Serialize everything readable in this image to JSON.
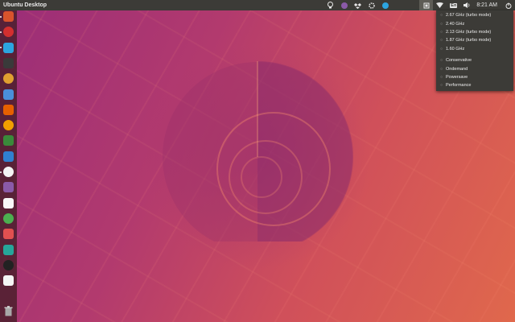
{
  "top_panel": {
    "title": "Ubuntu Desktop",
    "clock": "8:21 AM",
    "indicators": [
      "lightbulb-icon",
      "app-indicator-icon",
      "dropbox-icon",
      "settings-icon",
      "telegram-tray-icon",
      "cpufreq-icon",
      "wifi-icon",
      "keyboard-layout-icon",
      "volume-icon",
      "power-icon"
    ],
    "keyboard_layout": "En"
  },
  "launcher": {
    "items": [
      {
        "name": "ubuntu-software-icon",
        "color": "#d9532c"
      },
      {
        "name": "opera-icon",
        "color": "#d32f2f"
      },
      {
        "name": "telegram-icon",
        "color": "#2ca5e0"
      },
      {
        "name": "terminal-icon",
        "color": "#3a3a3a"
      },
      {
        "name": "files-icon",
        "color": "#e0a030"
      },
      {
        "name": "sync-icon",
        "color": "#4a90d9"
      },
      {
        "name": "firefox-icon",
        "color": "#e66000"
      },
      {
        "name": "vlc-icon",
        "color": "#f0a000"
      },
      {
        "name": "info-icon",
        "color": "#3a8a3a"
      },
      {
        "name": "drive-icon",
        "color": "#3080d0"
      },
      {
        "name": "paint-icon",
        "color": "#f4f4f4"
      },
      {
        "name": "idea-icon",
        "color": "#8a5aa8"
      },
      {
        "name": "player-icon",
        "color": "#f8f8f8"
      },
      {
        "name": "chrome-icon",
        "color": "#4caf50"
      },
      {
        "name": "recorder-icon",
        "color": "#e05050"
      },
      {
        "name": "activity-icon",
        "color": "#26a69a"
      },
      {
        "name": "inkscape-icon",
        "color": "#222222"
      },
      {
        "name": "pie-app-icon",
        "color": "#f5f5f5"
      }
    ],
    "trash": "trash-icon"
  },
  "cpu_menu": {
    "frequencies": [
      "2.67 GHz (turbo mode)",
      "2.40 GHz",
      "2.13 GHz (turbo mode)",
      "1.87 GHz (turbo mode)",
      "1.60 GHz"
    ],
    "governors": [
      "Conservative",
      "Ondemand",
      "Powersave",
      "Performance"
    ]
  }
}
